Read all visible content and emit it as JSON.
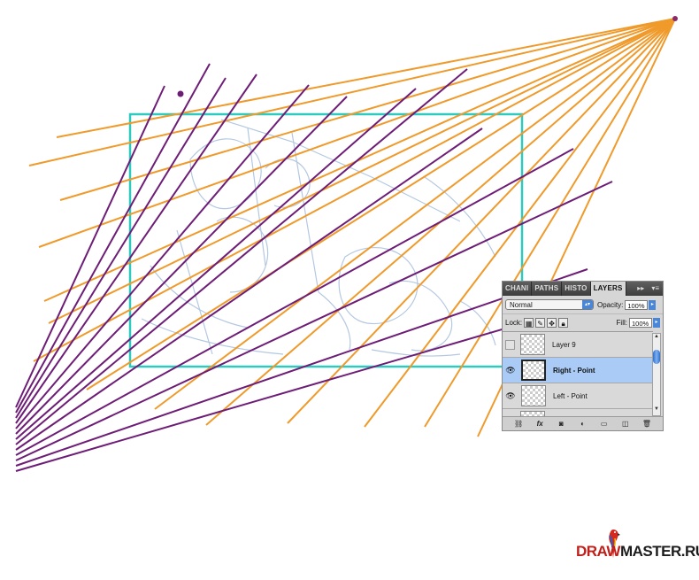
{
  "panel": {
    "tabs": [
      {
        "label": "CHANI",
        "active": false
      },
      {
        "label": "PATHS",
        "active": false
      },
      {
        "label": "HISTO",
        "active": false
      },
      {
        "label": "LAYERS",
        "active": true
      }
    ],
    "tab_expand_icon": "double-chevron-right-icon",
    "tab_menu_icon": "panel-menu-icon",
    "blend_mode": "Normal",
    "opacity_label": "Opacity:",
    "opacity_value": "100%",
    "lock_label": "Lock:",
    "fill_label": "Fill:",
    "fill_value": "100%",
    "layers": [
      {
        "name": "Layer 9",
        "visible": false,
        "selected": false
      },
      {
        "name": "Right - Point",
        "visible": true,
        "selected": true
      },
      {
        "name": "Left - Point",
        "visible": true,
        "selected": false
      },
      {
        "name": "",
        "visible": false,
        "selected": false
      }
    ],
    "footer_icons": [
      "link-layers-icon",
      "fx-icon",
      "layer-mask-icon",
      "adjustment-layer-icon",
      "new-group-icon",
      "new-layer-icon",
      "trash-icon"
    ],
    "footer_fx_label": "fx"
  },
  "logo": {
    "part1": "DRAW",
    "part2": "MASTER.RU"
  },
  "colors": {
    "orange_lines": "#ef9a2a",
    "purple_lines": "#6e1d77",
    "frame": "#2ec9bf",
    "sketch": "#9fb8d6",
    "selected_layer": "#a9cbf5"
  }
}
